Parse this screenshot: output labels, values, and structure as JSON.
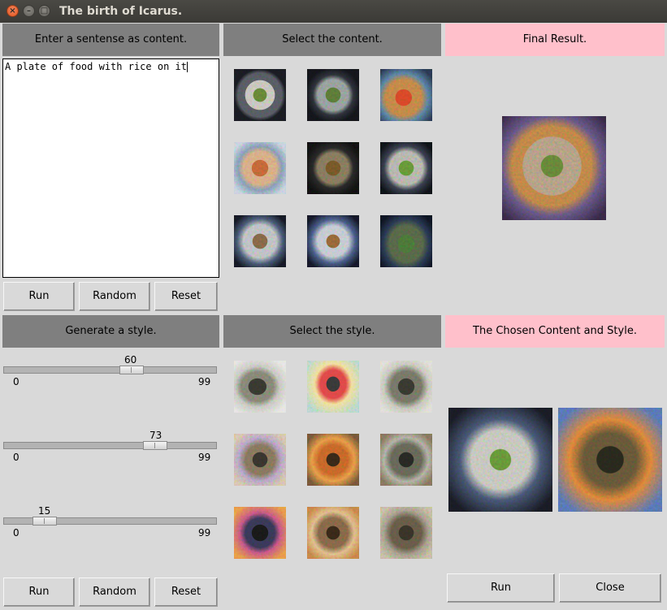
{
  "window": {
    "title": "The birth of Icarus."
  },
  "content_panel": {
    "header": "Enter a sentense as content.",
    "text": "A plate of food with rice on it",
    "buttons": {
      "run": "Run",
      "random": "Random",
      "reset": "Reset"
    }
  },
  "select_content": {
    "header": "Select the content."
  },
  "final_result": {
    "header": "Final Result."
  },
  "style_panel": {
    "header": "Generate a style.",
    "sliders": [
      {
        "value": "60",
        "min": "0",
        "max": "99"
      },
      {
        "value": "73",
        "min": "0",
        "max": "99"
      },
      {
        "value": "15",
        "min": "0",
        "max": "99"
      }
    ],
    "buttons": {
      "run": "Run",
      "random": "Random",
      "reset": "Reset"
    }
  },
  "select_style": {
    "header": "Select the style."
  },
  "chosen": {
    "header": "The Chosen Content and Style.",
    "buttons": {
      "run": "Run",
      "close": "Close"
    }
  },
  "colors": {
    "header_gray": "#7f7f7f",
    "header_pink": "#ffc0cb",
    "window_bg": "#d9d9d9"
  }
}
